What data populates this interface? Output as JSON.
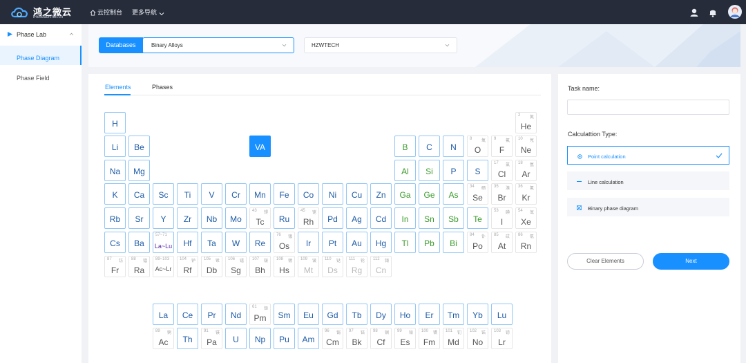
{
  "topbar": {
    "logo_title": "鸿之微云",
    "logo_subtitle": "iReseach.net.cn",
    "console": "云控制台",
    "more_nav": "更多导航"
  },
  "sidebar": {
    "group_label": "Phase Lab",
    "items": [
      {
        "label": "Phase Diagram",
        "active": true
      },
      {
        "label": "Phase Field",
        "active": false
      }
    ]
  },
  "header": {
    "databases_label": "Databases",
    "database_value": "Binary Alloys",
    "source_value": "HZWTECH"
  },
  "tabs": {
    "elements": "Elements",
    "phases": "Phases"
  },
  "periodic": {
    "selected": "VA",
    "va_label": "VA",
    "lanthanide_range": "57~71",
    "actinide_range": "89~103",
    "rows": [
      [
        {
          "s": "H"
        },
        {
          "n": "2",
          "z": "氦",
          "s": "He",
          "t": "g"
        }
      ],
      [
        {
          "s": "Li"
        },
        {
          "s": "Be"
        },
        {
          "s": "B",
          "t": "G"
        },
        {
          "s": "C"
        },
        {
          "s": "N"
        },
        {
          "n": "8",
          "z": "氧",
          "s": "O",
          "t": "g"
        },
        {
          "n": "9",
          "z": "氟",
          "s": "F",
          "t": "g"
        },
        {
          "n": "10",
          "z": "氖",
          "s": "Ne",
          "t": "g"
        }
      ],
      [
        {
          "s": "Na"
        },
        {
          "s": "Mg"
        },
        {
          "s": "Al",
          "t": "G"
        },
        {
          "s": "Si",
          "t": "G"
        },
        {
          "s": "P"
        },
        {
          "s": "S"
        },
        {
          "n": "17",
          "z": "氯",
          "s": "Cl",
          "t": "g"
        },
        {
          "n": "18",
          "z": "氩",
          "s": "Ar",
          "t": "g"
        }
      ],
      [
        {
          "s": "K"
        },
        {
          "s": "Ca"
        },
        {
          "s": "Sc"
        },
        {
          "s": "Ti"
        },
        {
          "s": "V"
        },
        {
          "s": "Cr"
        },
        {
          "s": "Mn"
        },
        {
          "s": "Fe"
        },
        {
          "s": "Co"
        },
        {
          "s": "Ni"
        },
        {
          "s": "Cu"
        },
        {
          "s": "Zn"
        },
        {
          "s": "Ga",
          "t": "G"
        },
        {
          "s": "Ge",
          "t": "G"
        },
        {
          "s": "As",
          "t": "G"
        },
        {
          "n": "34",
          "z": "硒",
          "s": "Se",
          "t": "g"
        },
        {
          "n": "35",
          "z": "溴",
          "s": "Br",
          "t": "g"
        },
        {
          "n": "36",
          "z": "氪",
          "s": "Kr",
          "t": "g"
        }
      ],
      [
        {
          "s": "Rb"
        },
        {
          "s": "Sr"
        },
        {
          "s": "Y"
        },
        {
          "s": "Zr"
        },
        {
          "s": "Nb"
        },
        {
          "s": "Mo"
        },
        {
          "n": "43",
          "z": "锝",
          "s": "Tc",
          "t": "g"
        },
        {
          "s": "Ru"
        },
        {
          "n": "45",
          "z": "铑",
          "s": "Rh",
          "t": "g"
        },
        {
          "s": "Pd"
        },
        {
          "s": "Ag"
        },
        {
          "s": "Cd"
        },
        {
          "s": "In",
          "t": "G"
        },
        {
          "s": "Sn",
          "t": "G"
        },
        {
          "s": "Sb",
          "t": "G"
        },
        {
          "s": "Te",
          "t": "G"
        },
        {
          "n": "53",
          "z": "碘",
          "s": "I",
          "t": "g"
        },
        {
          "n": "54",
          "z": "氙",
          "s": "Xe",
          "t": "g"
        }
      ],
      [
        {
          "s": "Cs"
        },
        {
          "s": "Ba"
        },
        {
          "s": "La~Lu",
          "t": "L"
        },
        {
          "s": "Hf"
        },
        {
          "s": "Ta"
        },
        {
          "s": "W"
        },
        {
          "s": "Re"
        },
        {
          "n": "76",
          "z": "锇",
          "s": "Os",
          "t": "g"
        },
        {
          "s": "Ir"
        },
        {
          "s": "Pt"
        },
        {
          "s": "Au"
        },
        {
          "s": "Hg"
        },
        {
          "s": "Tl",
          "t": "G"
        },
        {
          "s": "Pb",
          "t": "G"
        },
        {
          "s": "Bi",
          "t": "G"
        },
        {
          "n": "84",
          "z": "钋",
          "s": "Po",
          "t": "gG"
        },
        {
          "n": "85",
          "z": "砹",
          "s": "At",
          "t": "gG"
        },
        {
          "n": "86",
          "z": "氡",
          "s": "Rn",
          "t": "g"
        }
      ],
      [
        {
          "n": "87",
          "z": "钫",
          "s": "Fr",
          "t": "g"
        },
        {
          "n": "88",
          "z": "镭",
          "s": "Ra",
          "t": "g"
        },
        {
          "s": "Ac~Lr",
          "t": "A"
        },
        {
          "n": "104",
          "z": "𬬻",
          "s": "Rf",
          "t": "g"
        },
        {
          "n": "105",
          "z": "𬭊",
          "s": "Db",
          "t": "g"
        },
        {
          "n": "106",
          "z": "𬭳",
          "s": "Sg",
          "t": "g"
        },
        {
          "n": "107",
          "z": "𬭛",
          "s": "Bh",
          "t": "g"
        },
        {
          "n": "108",
          "z": "𬭶",
          "s": "Hs",
          "t": "g"
        },
        {
          "n": "109",
          "z": "鿏",
          "s": "Mt",
          "t": "gl"
        },
        {
          "n": "110",
          "z": "𫟼",
          "s": "Ds",
          "t": "gl"
        },
        {
          "n": "111",
          "z": "𬬭",
          "s": "Rg",
          "t": "gl"
        },
        {
          "n": "112",
          "z": "鿔",
          "s": "Cn",
          "t": "gl"
        }
      ]
    ],
    "lanthanides": [
      {
        "s": "La"
      },
      {
        "s": "Ce"
      },
      {
        "s": "Pr"
      },
      {
        "s": "Nd"
      },
      {
        "n": "61",
        "z": "钷",
        "s": "Pm",
        "t": "gP"
      },
      {
        "s": "Sm"
      },
      {
        "s": "Eu"
      },
      {
        "s": "Gd"
      },
      {
        "s": "Tb"
      },
      {
        "s": "Dy"
      },
      {
        "s": "Ho"
      },
      {
        "s": "Er"
      },
      {
        "s": "Tm"
      },
      {
        "s": "Yb"
      },
      {
        "s": "Lu"
      }
    ],
    "actinides": [
      {
        "n": "89",
        "z": "锕",
        "s": "Ac",
        "t": "g"
      },
      {
        "s": "Th"
      },
      {
        "n": "91",
        "z": "镤",
        "s": "Pa",
        "t": "g"
      },
      {
        "s": "U"
      },
      {
        "s": "Np"
      },
      {
        "s": "Pu"
      },
      {
        "s": "Am"
      },
      {
        "n": "96",
        "z": "锔",
        "s": "Cm",
        "t": "g"
      },
      {
        "n": "97",
        "z": "锫",
        "s": "Bk",
        "t": "g"
      },
      {
        "n": "98",
        "z": "锎",
        "s": "Cf",
        "t": "g"
      },
      {
        "n": "99",
        "z": "锿",
        "s": "Es",
        "t": "g"
      },
      {
        "n": "100",
        "z": "镄",
        "s": "Fm",
        "t": "g"
      },
      {
        "n": "101",
        "z": "钔",
        "s": "Md",
        "t": "g"
      },
      {
        "n": "102",
        "z": "锘",
        "s": "No",
        "t": "g"
      },
      {
        "n": "103",
        "z": "铹",
        "s": "Lr",
        "t": "g"
      }
    ]
  },
  "task": {
    "name_label": "Task name:",
    "name_value": "",
    "calc_type_label": "Calculattion Type:",
    "options": [
      {
        "label": "Point calculation",
        "selected": true,
        "icon": "target-icon"
      },
      {
        "label": "Line calculation",
        "selected": false,
        "icon": "dash-icon"
      },
      {
        "label": "Binary phase diagram",
        "selected": false,
        "icon": "diagram-icon"
      }
    ],
    "clear_label": "Clear Elements",
    "next_label": "Next"
  },
  "colors": {
    "accent": "#1890ff",
    "topbar": "#262c3a",
    "metal_text": "#1c5aa6",
    "nonmetal_text": "#3a9b2c",
    "lanthanide_text": "#5b2ea6"
  }
}
